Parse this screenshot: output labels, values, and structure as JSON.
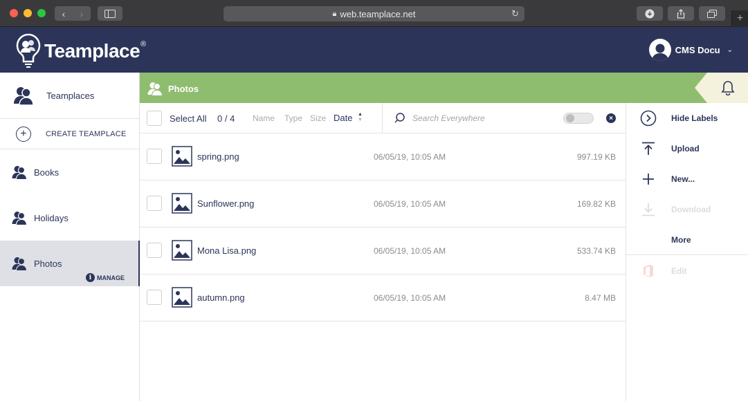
{
  "browser": {
    "url": "web.teamplace.net"
  },
  "header": {
    "logo_text": "Teamplace",
    "logo_mark": "®",
    "user_name": "CMS Docu"
  },
  "sidebar": {
    "teamplaces_label": "Teamplaces",
    "create_label": "CREATE TEAMPLACE",
    "items": [
      {
        "label": "Books"
      },
      {
        "label": "Holidays"
      },
      {
        "label": "Photos",
        "manage_label": "MANAGE"
      }
    ]
  },
  "banner": {
    "title": "Photos"
  },
  "toolbar": {
    "select_all_label": "Select All",
    "count": "0 / 4",
    "sort_name": "Name",
    "sort_type": "Type",
    "sort_size": "Size",
    "sort_date": "Date",
    "search_placeholder": "Search Everywhere"
  },
  "files": [
    {
      "name": "spring.png",
      "date": "06/05/19, 10:05 AM",
      "size": "997.19 KB"
    },
    {
      "name": "Sunflower.png",
      "date": "06/05/19, 10:05 AM",
      "size": "169.82 KB"
    },
    {
      "name": "Mona Lisa.png",
      "date": "06/05/19, 10:05 AM",
      "size": "533.74 KB"
    },
    {
      "name": "autumn.png",
      "date": "06/05/19, 10:05 AM",
      "size": "8.47 MB"
    }
  ],
  "actions": {
    "hide_labels": "Hide Labels",
    "upload": "Upload",
    "new": "New...",
    "download": "Download",
    "more": "More",
    "edit": "Edit"
  },
  "colors": {
    "header_navy": "#2c3559",
    "banner_green": "#8fbd6f",
    "bell_tab": "#f4f1dc",
    "selected_item": "#dfe0e6"
  }
}
